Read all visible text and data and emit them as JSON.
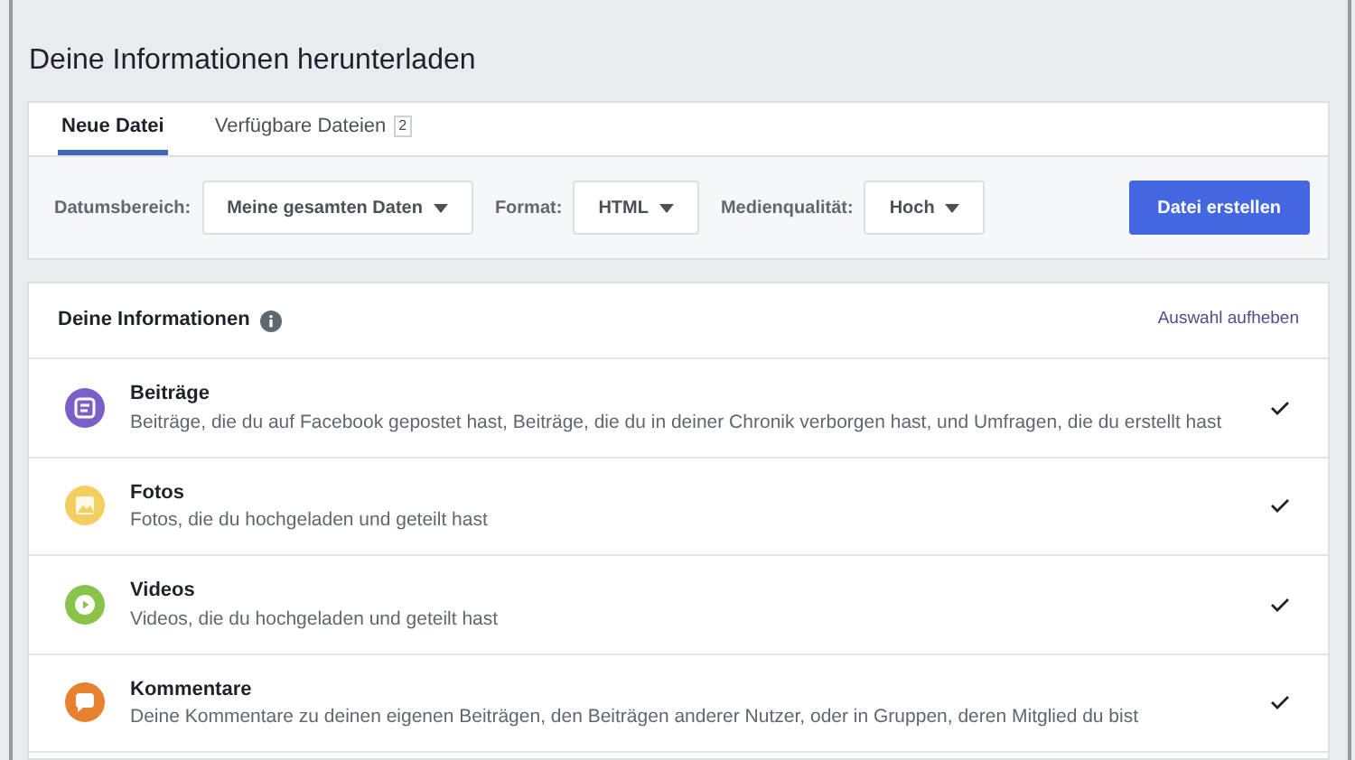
{
  "title": "Deine Informationen herunterladen",
  "tabs": [
    {
      "label": "Neue Datei",
      "selected": true
    },
    {
      "label": "Verfügbare Dateien",
      "count": "2",
      "selected": false
    }
  ],
  "filters": [
    {
      "label": "Datumsbereich:",
      "value": "Meine gesamten Daten"
    },
    {
      "label": "Format:",
      "value": "HTML"
    },
    {
      "label": "Medienqualität:",
      "value": "Hoch"
    }
  ],
  "create_button": "Datei erstellen",
  "section": {
    "title": "Deine Informationen",
    "deselect_link": "Auswahl aufheben",
    "items": [
      {
        "kind": "posts",
        "color": "#7a5fc8",
        "title": "Beiträge",
        "description": "Beiträge, die du auf Facebook gepostet hast, Beiträge, die du in deiner Chronik verborgen hast, und Umfragen, die du erstellt hast",
        "checked": true
      },
      {
        "kind": "photos",
        "color": "#f2cf5f",
        "title": "Fotos",
        "description": "Fotos, die du hochgeladen und geteilt hast",
        "checked": true
      },
      {
        "kind": "videos",
        "color": "#8bc34a",
        "title": "Videos",
        "description": "Videos, die du hochgeladen und geteilt hast",
        "checked": true
      },
      {
        "kind": "comments",
        "color": "#e8812f",
        "title": "Kommentare",
        "description": "Deine Kommentare zu deinen eigenen Beiträgen, den Beiträgen anderer Nutzer, oder in Gruppen, deren Mitglied du bist",
        "checked": true
      }
    ]
  }
}
